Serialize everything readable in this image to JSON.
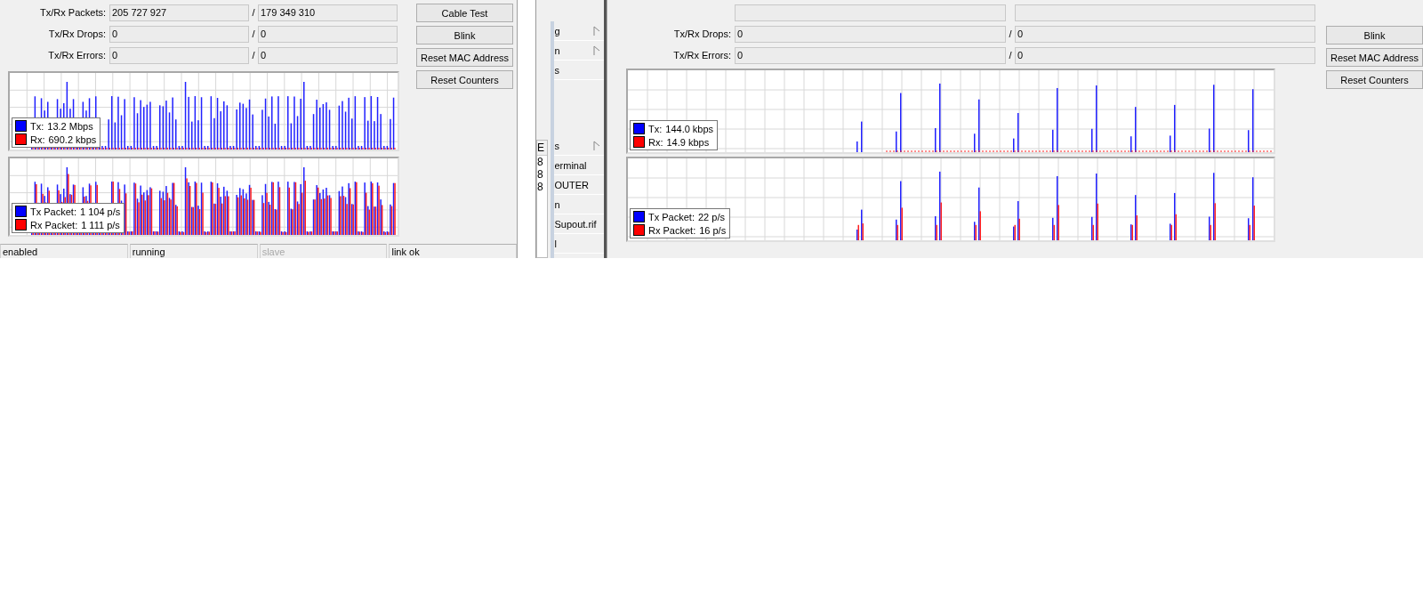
{
  "left_window": {
    "fields": [
      {
        "label": "Tx/Rx Packets:",
        "tx": "205 727 927",
        "separator": "/",
        "rx": "179 349 310"
      },
      {
        "label": "Tx/Rx Drops:",
        "tx": "0",
        "separator": "/",
        "rx": "0"
      },
      {
        "label": "Tx/Rx Errors:",
        "tx": "0",
        "separator": "/",
        "rx": "0"
      }
    ],
    "buttons": [
      "Cable Test",
      "Blink",
      "Reset MAC Address",
      "Reset Counters"
    ],
    "traffic_legend": [
      {
        "label": "Tx:",
        "value": "13.2 Mbps",
        "color": "#0000ff"
      },
      {
        "label": "Rx:",
        "value": "690.2 kbps",
        "color": "#ff0000"
      }
    ],
    "packet_legend": [
      {
        "label": "Tx Packet:",
        "value": "1 104 p/s",
        "color": "#0000ff"
      },
      {
        "label": "Rx Packet:",
        "value": "1 111 p/s",
        "color": "#ff0000"
      }
    ],
    "status_bar": [
      {
        "text": "enabled",
        "disabled": false
      },
      {
        "text": "running",
        "disabled": false
      },
      {
        "text": "slave",
        "disabled": true
      },
      {
        "text": "link ok",
        "disabled": false
      }
    ]
  },
  "sidebar": {
    "list_fragment": {
      "header": "E",
      "cells": [
        "8",
        "8",
        "8"
      ]
    },
    "items": [
      {
        "label": "g",
        "submenu": true
      },
      {
        "label": "n",
        "submenu": true
      },
      {
        "label": "s",
        "submenu": false
      },
      {
        "label": "s",
        "submenu": true
      },
      {
        "label": "erminal",
        "submenu": false
      },
      {
        "label": "OUTER",
        "submenu": false
      },
      {
        "label": "n",
        "submenu": false
      },
      {
        "label": "Supout.rif",
        "submenu": false
      },
      {
        "label": "l",
        "submenu": false
      }
    ]
  },
  "right_window": {
    "fields": [
      {
        "label": "Tx/Rx Drops:",
        "tx": "0",
        "separator": "/",
        "rx": "0"
      },
      {
        "label": "Tx/Rx Errors:",
        "tx": "0",
        "separator": "/",
        "rx": "0"
      }
    ],
    "buttons": [
      "Blink",
      "Reset MAC Address",
      "Reset Counters"
    ],
    "traffic_legend": [
      {
        "label": "Tx:",
        "value": "144.0 kbps",
        "color": "#0000ff"
      },
      {
        "label": "Rx:",
        "value": "14.9 kbps",
        "color": "#ff0000"
      }
    ],
    "packet_legend": [
      {
        "label": "Tx Packet:",
        "value": "22 p/s",
        "color": "#0000ff"
      },
      {
        "label": "Rx Packet:",
        "value": "16 p/s",
        "color": "#ff0000"
      }
    ]
  }
}
